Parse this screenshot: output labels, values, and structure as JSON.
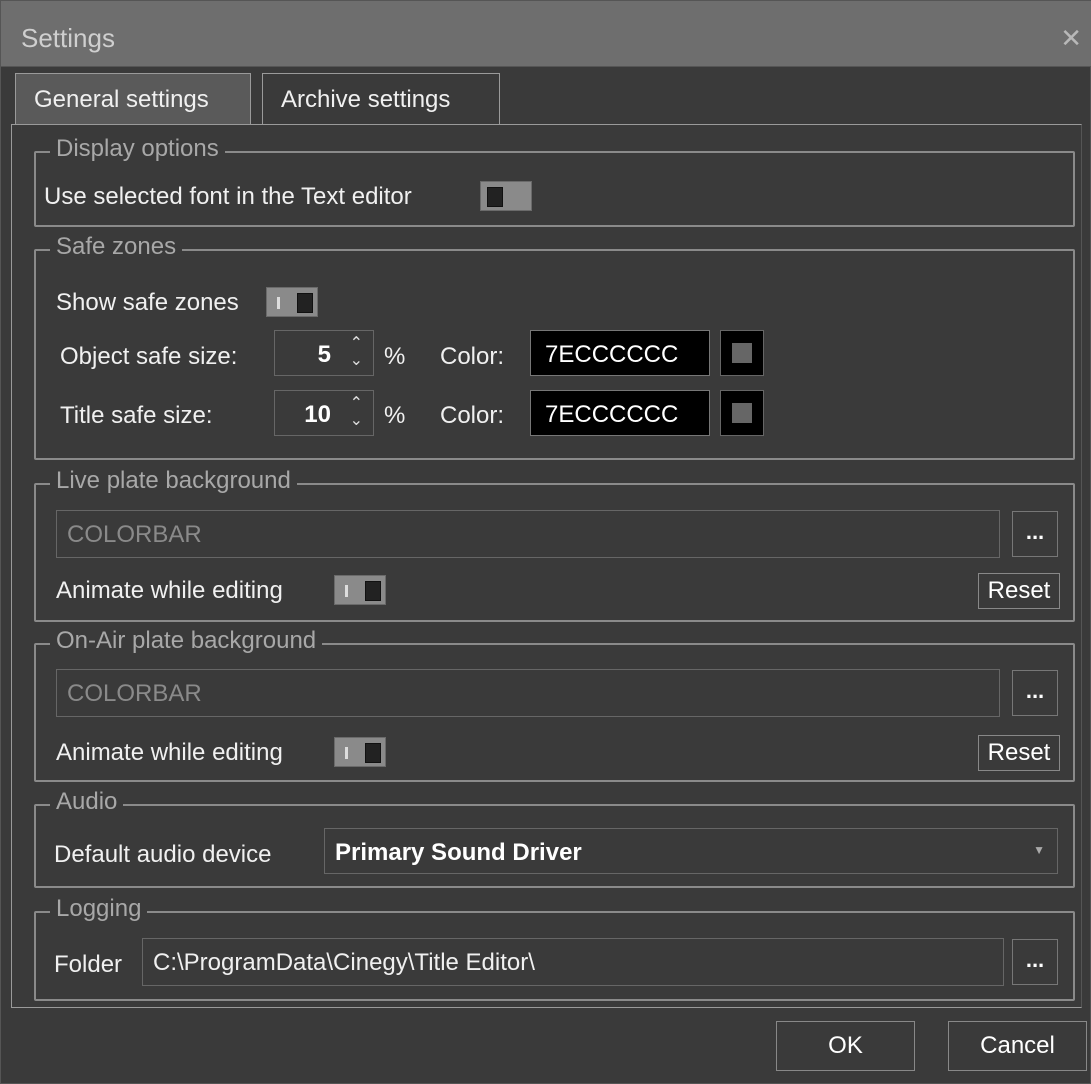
{
  "window": {
    "title": "Settings"
  },
  "tabs": [
    {
      "label": "General settings",
      "active": true
    },
    {
      "label": "Archive  settings",
      "active": false
    }
  ],
  "display_options": {
    "legend": "Display options",
    "use_font_label": "Use selected font in the Text editor",
    "use_font_enabled": false
  },
  "safe_zones": {
    "legend": "Safe zones",
    "show_label": "Show safe zones",
    "show_enabled": true,
    "object_label": "Object safe size:",
    "object_value": "5",
    "object_unit": "%",
    "object_color_label": "Color:",
    "object_color_value": "7ECCCCCC",
    "title_label": "Title safe size:",
    "title_value": "10",
    "title_unit": "%",
    "title_color_label": "Color:",
    "title_color_value": "7ECCCCCC"
  },
  "live_plate": {
    "legend": "Live plate background",
    "value": "COLORBAR",
    "browse_label": "...",
    "animate_label": "Animate while editing",
    "animate_enabled": true,
    "reset_label": "Reset"
  },
  "onair_plate": {
    "legend": "On-Air plate background",
    "value": "COLORBAR",
    "browse_label": "...",
    "animate_label": "Animate while editing",
    "animate_enabled": true,
    "reset_label": "Reset"
  },
  "audio": {
    "legend": "Audio",
    "device_label": "Default audio device",
    "device_value": "Primary Sound Driver"
  },
  "logging": {
    "legend": "Logging",
    "folder_label": "Folder",
    "folder_value": "C:\\ProgramData\\Cinegy\\Title Editor\\",
    "browse_label": "..."
  },
  "footer": {
    "ok_label": "OK",
    "cancel_label": "Cancel"
  },
  "icons": {
    "close": "close-icon",
    "spin": "spinner-arrows-icon",
    "dropdown": "chevron-down-icon"
  },
  "colors": {
    "background": "#3a3a3a",
    "titlebar": "#6e6e6e",
    "color_field": "#000000"
  }
}
